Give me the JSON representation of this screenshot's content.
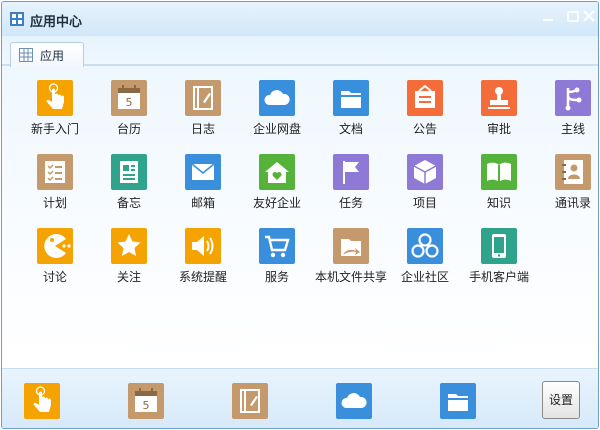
{
  "window": {
    "title": "应用中心",
    "min_glyph": "—",
    "max_glyph": "□",
    "close_glyph": "×"
  },
  "tab": {
    "label": "应用"
  },
  "apps": [
    {
      "label": "新手入门",
      "icon": "hand-pointer-icon",
      "color": "#f5a300"
    },
    {
      "label": "台历",
      "icon": "calendar-icon",
      "color": "#c49a6c"
    },
    {
      "label": "日志",
      "icon": "notebook-icon",
      "color": "#c49a6c"
    },
    {
      "label": "企业网盘",
      "icon": "cloud-icon",
      "color": "#3a8fdc"
    },
    {
      "label": "文档",
      "icon": "folder-icon",
      "color": "#3a8fdc"
    },
    {
      "label": "公告",
      "icon": "notice-board-icon",
      "color": "#f36c3a"
    },
    {
      "label": "审批",
      "icon": "stamp-icon",
      "color": "#f36c3a"
    },
    {
      "label": "主线",
      "icon": "mainline-icon",
      "color": "#8e79d6"
    },
    {
      "label": "计划",
      "icon": "checklist-icon",
      "color": "#c49a6c"
    },
    {
      "label": "备忘",
      "icon": "memo-icon",
      "color": "#2fa38c"
    },
    {
      "label": "邮箱",
      "icon": "envelope-icon",
      "color": "#3a8fdc"
    },
    {
      "label": "友好企业",
      "icon": "house-heart-icon",
      "color": "#55b23a"
    },
    {
      "label": "任务",
      "icon": "flag-icon",
      "color": "#8e79d6"
    },
    {
      "label": "项目",
      "icon": "cube-icon",
      "color": "#8e79d6"
    },
    {
      "label": "知识",
      "icon": "open-book-icon",
      "color": "#55b23a"
    },
    {
      "label": "通讯录",
      "icon": "contact-book-icon",
      "color": "#c49a6c"
    },
    {
      "label": "讨论",
      "icon": "pacman-chat-icon",
      "color": "#f5a300"
    },
    {
      "label": "关注",
      "icon": "star-icon",
      "color": "#f5a300"
    },
    {
      "label": "系统提醒",
      "icon": "speaker-icon",
      "color": "#f5a300"
    },
    {
      "label": "服务",
      "icon": "shopping-cart-icon",
      "color": "#3a8fdc"
    },
    {
      "label": "本机文件共享",
      "icon": "file-share-icon",
      "color": "#c49a6c"
    },
    {
      "label": "企业社区",
      "icon": "community-icon",
      "color": "#3a8fdc"
    },
    {
      "label": "手机客户端",
      "icon": "mobile-phone-icon",
      "color": "#2fa38c"
    }
  ],
  "dock": [
    {
      "icon": "hand-pointer-icon",
      "color": "#f5a300"
    },
    {
      "icon": "calendar-icon",
      "color": "#c49a6c"
    },
    {
      "icon": "notebook-icon",
      "color": "#c49a6c"
    },
    {
      "icon": "cloud-icon",
      "color": "#3a8fdc"
    },
    {
      "icon": "folder-icon",
      "color": "#3a8fdc"
    }
  ],
  "settings_label": "设置",
  "calendar_day": "5"
}
